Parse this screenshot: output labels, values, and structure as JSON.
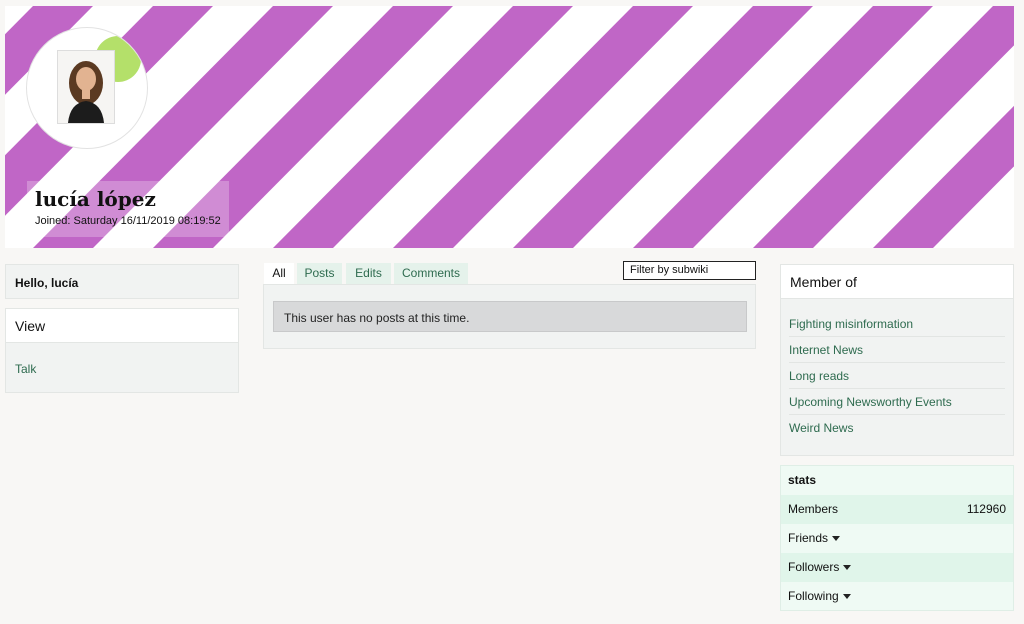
{
  "profile": {
    "name": "lucía lópez",
    "joined": "Joined: Saturday 16/11/2019 08:19:52"
  },
  "colors": {
    "banner_stripe": "#c066c6",
    "avatar_blob": "#b4e06a",
    "link": "#2e6b4f"
  },
  "sidebar": {
    "hello": "Hello, lucía",
    "view_title": "View",
    "talk_link": "Talk"
  },
  "tabs": [
    {
      "label": "All"
    },
    {
      "label": "Posts"
    },
    {
      "label": "Edits"
    },
    {
      "label": "Comments"
    }
  ],
  "filter": {
    "value": "Filter by subwiki"
  },
  "posts": {
    "empty_message": "This user has no posts at this time."
  },
  "member_of": {
    "title": "Member of",
    "items": [
      {
        "label": "Fighting misinformation"
      },
      {
        "label": "Internet News"
      },
      {
        "label": "Long reads"
      },
      {
        "label": "Upcoming Newsworthy Events"
      },
      {
        "label": "Weird News"
      }
    ]
  },
  "stats": {
    "title": "stats",
    "members_label": "Members",
    "members_value": "112960",
    "friends_label": "Friends",
    "followers_label": "Followers",
    "following_label": "Following"
  }
}
